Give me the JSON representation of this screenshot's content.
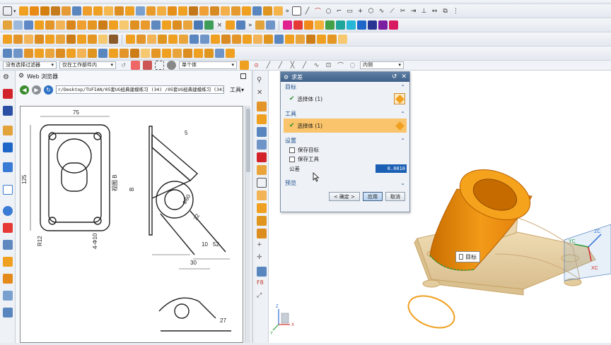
{
  "filter_bar": {
    "filter_select": "没有选择过滤器",
    "scope_select": "仅在工作部件内",
    "body_select": "单个体",
    "snap_select": "内侧"
  },
  "web_browser": {
    "title": "Web 浏览器",
    "url": "r/Desktop/TUFIAN/05套UG经典建模练习 (34) /05套UG经典建模练习 (34) .png",
    "tools_label": "工具",
    "drawing_labels": {
      "dim_75": "75",
      "dim_125": "125",
      "dim_r12": "R12",
      "dim_holes": "4-Φ10",
      "view_label": "视图 B",
      "b_label": "B",
      "dim_60": "Φ60",
      "dim_52": "52",
      "dim_30": "30",
      "dim_10": "10",
      "dim_32": "32",
      "dim_27": "27",
      "dim_5": "5"
    }
  },
  "dialog": {
    "title": "求差",
    "sections": {
      "target": {
        "label": "目标",
        "row_text": "选择体 (1)"
      },
      "tool": {
        "label": "工具",
        "row_text": "选择体 (1)"
      },
      "settings": {
        "label": "设置",
        "keep_target": "保存目标",
        "keep_tool": "保存工具",
        "tolerance_label": "公差",
        "tolerance_value": "0.0010"
      },
      "preview": {
        "label": "预览"
      }
    },
    "buttons": {
      "ok": "< 确定 >",
      "apply": "应用",
      "cancel": "取消"
    }
  },
  "viewport": {
    "target_tag": "目标",
    "axis_x": "XC",
    "axis_y": "YC",
    "axis_z": "ZC",
    "triad_x": "X",
    "triad_y": "Y",
    "triad_z": "Z"
  },
  "colors": {
    "accent_orange": "#f0a020",
    "dialog_blue": "#3f6189",
    "highlight_row": "#f9c46b"
  }
}
